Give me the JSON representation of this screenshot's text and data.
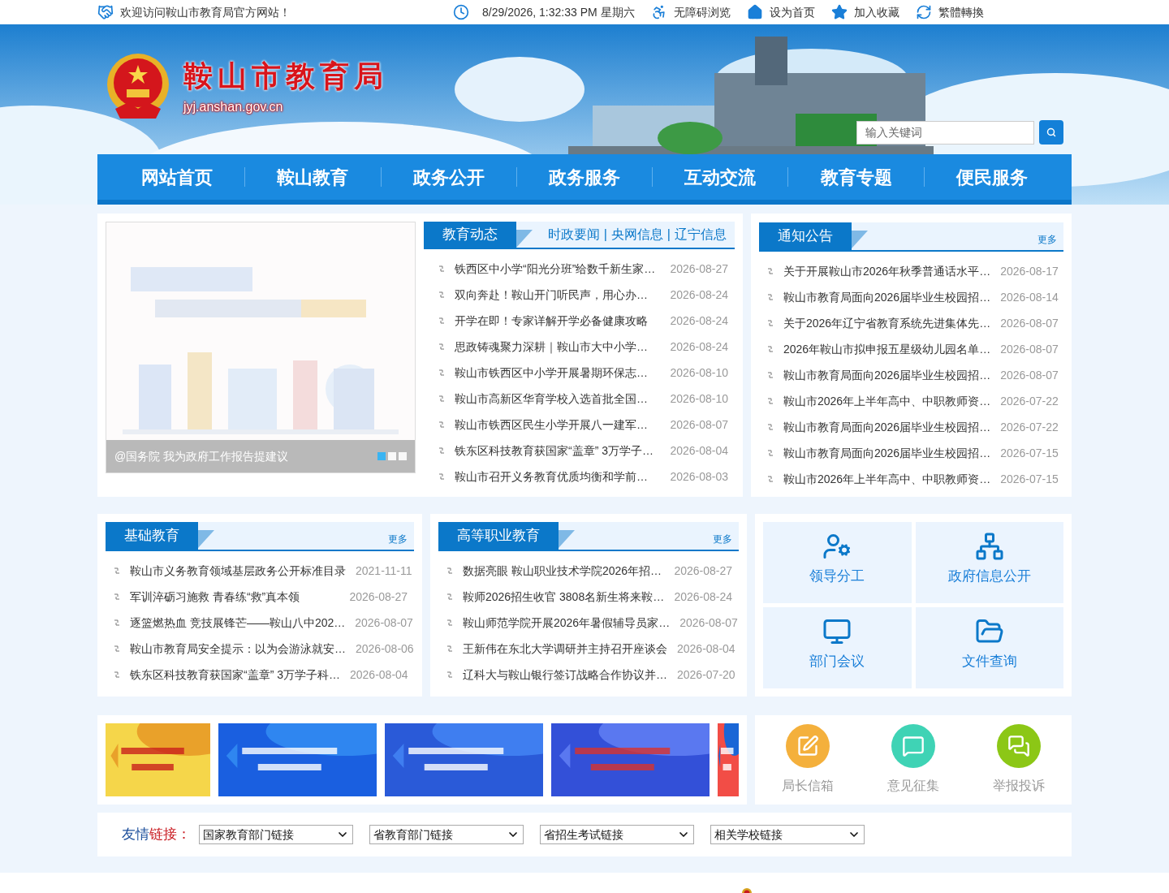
{
  "top_bar": {
    "welcome": "欢迎访问鞍山市教育局官方网站！",
    "datetime": "8/29/2026, 1:32:33 PM 星期六",
    "links": [
      {
        "kind": "accessibility",
        "label": "无障碍浏览"
      },
      {
        "kind": "home",
        "label": "设为首页"
      },
      {
        "kind": "favorite",
        "label": "加入收藏"
      },
      {
        "kind": "convert",
        "label": "繁體轉換"
      }
    ]
  },
  "header": {
    "title": "鞍山市教育局",
    "domain": "jyj.anshan.gov.cn",
    "search": {
      "placeholder": "输入关键词"
    }
  },
  "nav": [
    "网站首页",
    "鞍山教育",
    "政务公开",
    "政务服务",
    "互动交流",
    "教育专题",
    "便民服务"
  ],
  "slider": {
    "caption": "@国务院 我为政府工作报告提建议",
    "dots": [
      {
        "selected": true
      },
      {
        "selected": false
      },
      {
        "selected": false
      }
    ]
  },
  "news": {
    "title": "教育动态",
    "separator": "|",
    "links": [
      "时政要闻",
      "央网信息",
      "辽宁信息"
    ],
    "items": [
      {
        "title": "铁西区中小学“阳光分班”给数千新生家…",
        "date": "2026-08-27"
      },
      {
        "title": "双向奔赴！鞍山开门听民声，用心办…",
        "date": "2026-08-24"
      },
      {
        "title": "开学在即！专家详解开学必备健康攻略",
        "date": "2026-08-24"
      },
      {
        "title": "思政铸魂聚力深耕｜鞍山市大中小学…",
        "date": "2026-08-24"
      },
      {
        "title": "鞍山市铁西区中小学开展暑期环保志…",
        "date": "2026-08-10"
      },
      {
        "title": "鞍山市高新区华育学校入选首批全国…",
        "date": "2026-08-10"
      },
      {
        "title": "鞍山市铁西区民生小学开展八一建军…",
        "date": "2026-08-07"
      },
      {
        "title": "铁东区科技教育获国家“盖章” 3万学子…",
        "date": "2026-08-04"
      },
      {
        "title": "鞍山市召开义务教育优质均衡和学前…",
        "date": "2026-08-03"
      }
    ]
  },
  "notices": {
    "title": "通知公告",
    "more": "更多",
    "items": [
      {
        "title": "关于开展鞍山市2026年秋季普通话水平…",
        "date": "2026-08-17"
      },
      {
        "title": "鞍山市教育局面向2026届毕业生校园招…",
        "date": "2026-08-14"
      },
      {
        "title": "关于2026年辽宁省教育系统先进集体先…",
        "date": "2026-08-07"
      },
      {
        "title": "2026年鞍山市拟申报五星级幼儿园名单…",
        "date": "2026-08-07"
      },
      {
        "title": "鞍山市教育局面向2026届毕业生校园招…",
        "date": "2026-08-07"
      },
      {
        "title": "鞍山市2026年上半年高中、中职教师资…",
        "date": "2026-07-22"
      },
      {
        "title": "鞍山市教育局面向2026届毕业生校园招…",
        "date": "2026-07-22"
      },
      {
        "title": "鞍山市教育局面向2026届毕业生校园招…",
        "date": "2026-07-15"
      },
      {
        "title": "鞍山市2026年上半年高中、中职教师资…",
        "date": "2026-07-15"
      }
    ]
  },
  "basic_education": {
    "title": "基础教育",
    "more": "更多",
    "items": [
      {
        "title": "鞍山市义务教育领域基层政务公开标准目录",
        "date": "2021-11-11"
      },
      {
        "title": "军训淬砺习施救 青春练“救”真本领",
        "date": "2026-08-27"
      },
      {
        "title": "逐篮燃热血 竞技展锋芒——鞍山八中202…",
        "date": "2026-08-07"
      },
      {
        "title": "鞍山市教育局安全提示：以为会游泳就安…",
        "date": "2026-08-06"
      },
      {
        "title": "铁东区科技教育获国家“盖章” 3万学子科…",
        "date": "2026-08-04"
      }
    ]
  },
  "higher_education": {
    "title": "高等职业教育",
    "more": "更多",
    "items": [
      {
        "title": "数据亮眼 鞍山职业技术学院2026年招…",
        "date": "2026-08-27"
      },
      {
        "title": "鞍师2026招生收官 3808名新生将来鞍…",
        "date": "2026-08-24"
      },
      {
        "title": "鞍山师范学院开展2026年暑假辅导员家…",
        "date": "2026-08-07"
      },
      {
        "title": "王新伟在东北大学调研并主持召开座谈会",
        "date": "2026-08-04"
      },
      {
        "title": "辽科大与鞍山银行签订战略合作协议并…",
        "date": "2026-07-20"
      }
    ]
  },
  "quick_links": [
    {
      "kind": "leaders",
      "label": "领导分工"
    },
    {
      "kind": "org",
      "label": "政府信息公开"
    },
    {
      "kind": "meeting",
      "label": "部门会议"
    },
    {
      "kind": "files",
      "label": "文件查询"
    }
  ],
  "services": [
    {
      "kind": "mail",
      "label": "局长信箱",
      "color": "#f4b03c"
    },
    {
      "kind": "opinion",
      "label": "意见征集",
      "color": "#3fd3b5"
    },
    {
      "kind": "report",
      "label": "举报投诉",
      "color": "#8cc716"
    }
  ],
  "friend_links": {
    "label_part1": "友情",
    "label_part2": "链接：",
    "selects": [
      {
        "value": "国家教育部门链接"
      },
      {
        "value": "省教育部门链接"
      },
      {
        "value": "省招生考试链接"
      },
      {
        "value": "相关学校链接"
      }
    ]
  }
}
